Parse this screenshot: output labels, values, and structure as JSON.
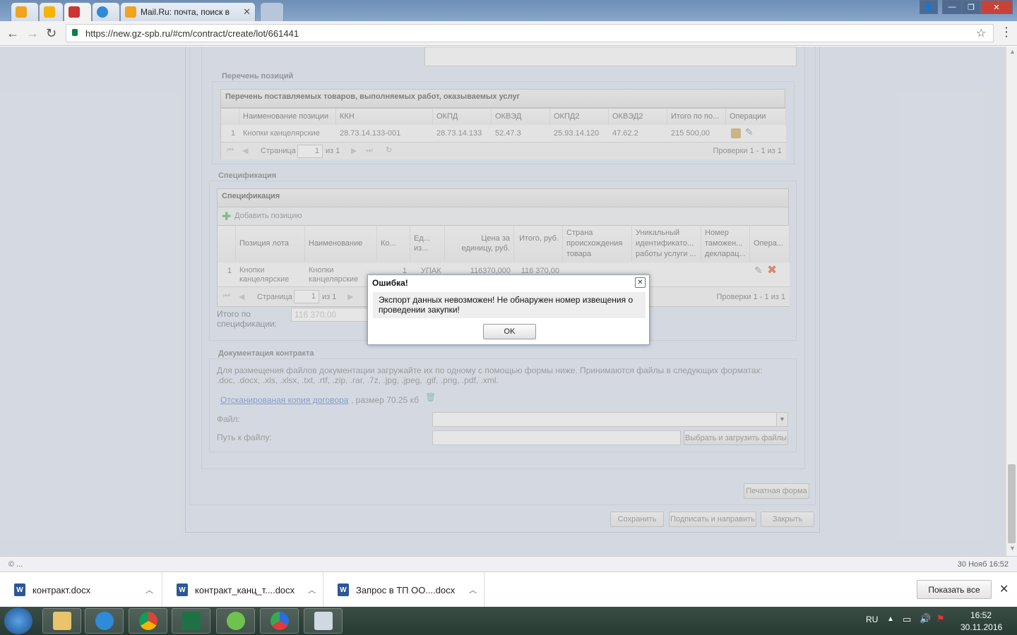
{
  "browser": {
    "tabs": [
      {
        "label": ""
      },
      {
        "label": ""
      },
      {
        "label": ""
      },
      {
        "label": ""
      },
      {
        "label": "Mail.Ru: почта, поиск в"
      },
      {
        "label": ""
      }
    ],
    "url": "https://new.gz-spb.ru/#cm/contract/create/lot/661441",
    "status_left": "© ...",
    "status_right": "30 Нояб 16:52"
  },
  "positions": {
    "legend": "Перечень позиций",
    "grid_title": "Перечень поставляемых товаров, выполняемых работ, оказываемых услуг",
    "columns": [
      "Наименование позиции",
      "ККН",
      "ОКПД",
      "ОКВЭД",
      "ОКПД2",
      "ОКВЭД2",
      "Итого по по...",
      "Операции"
    ],
    "rows": [
      {
        "num": "1",
        "name": "Кнопки канцелярские",
        "kkn": "28.73.14.133-001",
        "okpd": "28.73.14.133",
        "okved": "52.47.3",
        "okpd2": "25.93.14.120",
        "okved2": "47.62.2",
        "total": "215 500,00"
      }
    ],
    "pager": {
      "page_label": "Страница",
      "page": "1",
      "of": "из 1",
      "records": "Проверки 1 - 1 из 1"
    }
  },
  "spec": {
    "legend": "Спецификация",
    "grid_title": "Спецификация",
    "add_label": "Добавить позицию",
    "columns": [
      "Позиция лота",
      "Наименование",
      "Ко...",
      "Ед... из...",
      "Цена за единицу, руб.",
      "Итого, руб.",
      "Страна происхождения товара",
      "Уникальный идентификато... работы услуги ...",
      "Номер таможен... декларац...",
      "Опера..."
    ],
    "rows": [
      {
        "num": "1",
        "pos": "Кнопки канцелярские",
        "name": "Кнопки канцелярские",
        "qty": "1",
        "unit": "УПАК",
        "price": "116370,000",
        "total": "116 370,00"
      }
    ],
    "pager": {
      "page_label": "Страница",
      "page": "1",
      "of": "из 1",
      "records": "Проверки 1 - 1 из 1"
    },
    "total_label": "Итого по спецификации:",
    "total_value": "116 370,00"
  },
  "docs": {
    "legend": "Документация контракта",
    "info": "Для размещения файлов документации загружайте их по одному с помощью формы ниже. Принимаются файлы в следующих форматах: .doc, .docx, .xls, .xlsx, .txt, .rtf, .zip, .rar, .7z, .jpg, .jpeg, .gif, .png, .pdf, .xml.",
    "link": "Отсканированая копия договора",
    "size": ", размер 70.25 кб",
    "file_label": "Файл:",
    "path_label": "Путь к файлу:",
    "upload_button": "Выбрать и загрузить файлы"
  },
  "actions": {
    "print": "Печатная форма",
    "save": "Сохранить",
    "sign": "Подписать и направить",
    "close": "Закрыть"
  },
  "dialog": {
    "title": "Ошибка!",
    "message": "Экспорт данных невозможен! Не обнаружен номер извещения о проведении закупки!",
    "ok": "OK"
  },
  "downloads": {
    "items": [
      {
        "label": "контракт.docx"
      },
      {
        "label": "контракт_канц_т....docx"
      },
      {
        "label": "Запрос в ТП ОО....docx"
      }
    ],
    "show_all": "Показать все"
  },
  "taskbar": {
    "lang": "RU",
    "time": "16:52",
    "date": "30.11.2016"
  }
}
